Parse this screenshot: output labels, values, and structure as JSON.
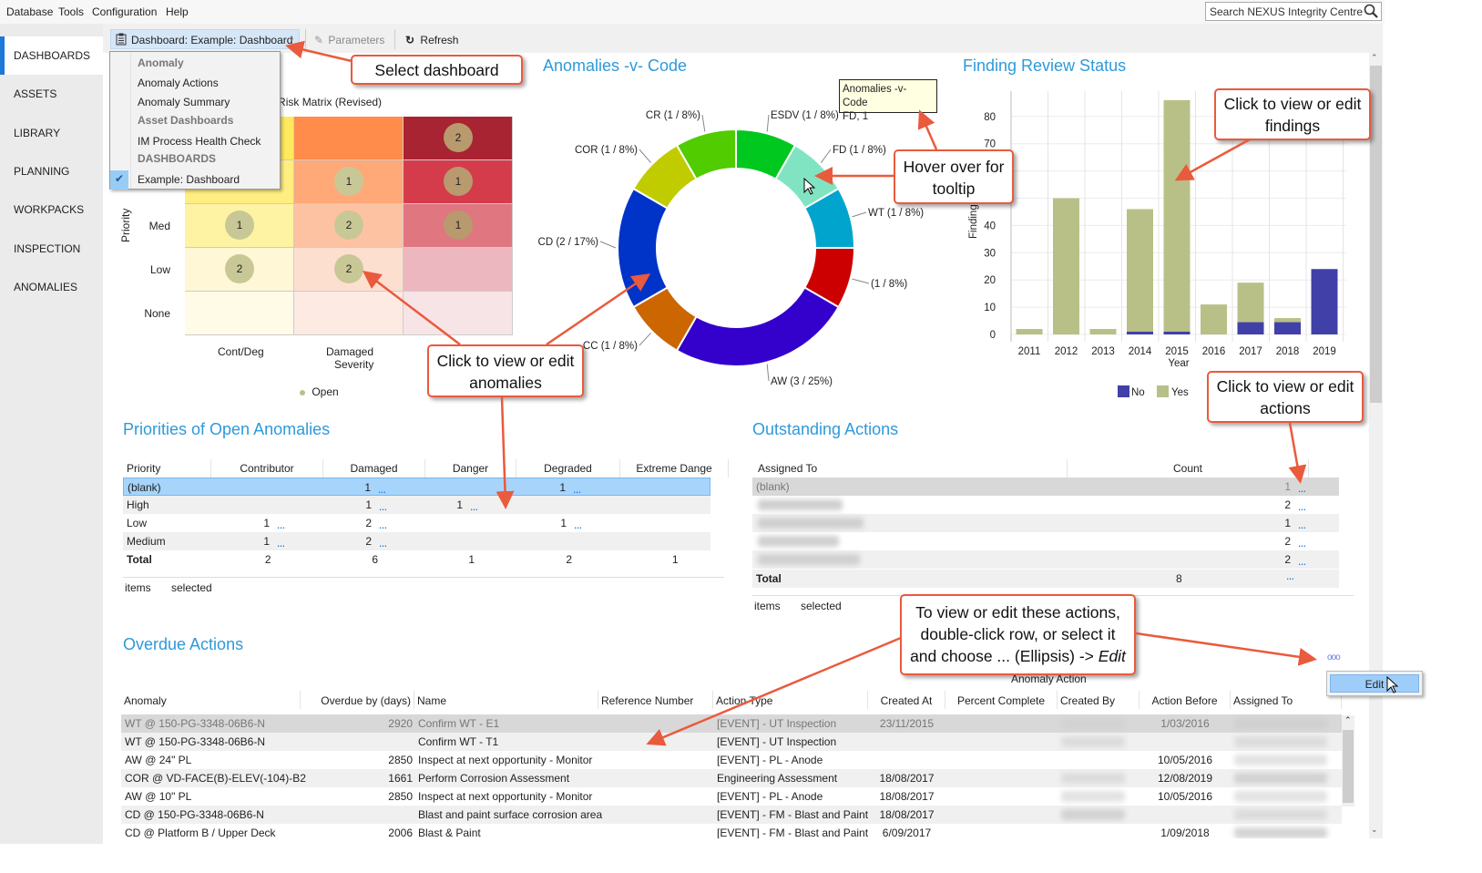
{
  "menu": {
    "items": [
      "Database",
      "Tools",
      "Configuration",
      "Help"
    ]
  },
  "search": {
    "placeholder": "Search NEXUS Integrity Centre"
  },
  "sidebar": {
    "items": [
      "DASHBOARDS",
      "ASSETS",
      "LIBRARY",
      "PLANNING",
      "WORKPACKS",
      "INSPECTION",
      "ANOMALIES"
    ],
    "selected": "DASHBOARDS"
  },
  "toolbar": {
    "dashboard_label": "Dashboard: Example: Dashboard",
    "parameters_label": "Parameters",
    "refresh_label": "Refresh"
  },
  "dropdown": {
    "items": [
      {
        "label": "Anomaly",
        "type": "header"
      },
      {
        "label": "Anomaly Actions",
        "type": "item"
      },
      {
        "label": "Anomaly Summary",
        "type": "item"
      },
      {
        "label": "Asset Dashboards",
        "type": "header"
      },
      {
        "label": "IM Process Health Check",
        "type": "item"
      },
      {
        "label": "DASHBOARDS",
        "type": "header"
      },
      {
        "label": "Example: Dashboard",
        "type": "item",
        "checked": true
      }
    ]
  },
  "risk_matrix": {
    "title": "Anomaly Risk Matrix (Revised)",
    "y_label": "Priority",
    "row_labels": [
      "",
      "",
      "Med",
      "Low",
      "None"
    ],
    "col_labels": [
      "Cont/Deg",
      "Damaged",
      ""
    ],
    "x_title": "Severity",
    "legend": "Open",
    "counts": [
      [
        null,
        null,
        2
      ],
      [
        null,
        1,
        1
      ],
      [
        1,
        2,
        1
      ],
      [
        2,
        2,
        null
      ],
      [
        null,
        null,
        null
      ]
    ],
    "colors": [
      [
        "#ffe95e",
        "#ff8c4a",
        "#a82432"
      ],
      [
        "#ffee80",
        "#ffa878",
        "#d53c4b"
      ],
      [
        "#fef3a2",
        "#fdc2a2",
        "#e07680"
      ],
      [
        "#fff7d6",
        "#fddfd0",
        "#edb7bf"
      ],
      [
        "#fffbe6",
        "#fdebe3",
        "#f7e4e7"
      ]
    ]
  },
  "donut": {
    "title": "Anomalies -v- Code",
    "segments": [
      {
        "code": "ESDV",
        "label": "ESDV (1 / 8%)",
        "value": 1,
        "color": "#00c81e"
      },
      {
        "code": "FD",
        "label": "FD (1 / 8%)",
        "value": 1,
        "color": "#80e4c2"
      },
      {
        "code": "WT",
        "label": "WT (1 / 8%)",
        "value": 1,
        "color": "#00a4cc"
      },
      {
        "code": "",
        "label": "(1 / 8%)",
        "value": 1,
        "color": "#cc0000"
      },
      {
        "code": "AW",
        "label": "AW (3 / 25%)",
        "value": 3,
        "color": "#3300cc"
      },
      {
        "code": "CC",
        "label": "CC (1 / 8%)",
        "value": 1,
        "color": "#cc6600"
      },
      {
        "code": "CD",
        "label": "CD (2 / 17%)",
        "value": 2,
        "color": "#0033c8"
      },
      {
        "code": "COR",
        "label": "COR (1 / 8%)",
        "value": 1,
        "color": "#c0cc00"
      },
      {
        "code": "CR",
        "label": "CR (1 / 8%)",
        "value": 1,
        "color": "#50cc00"
      }
    ]
  },
  "tooltip": {
    "line1": "Anomalies -v- Code",
    "line2": "FD, 1"
  },
  "chart_data": {
    "type": "bar",
    "stacked": true,
    "title": "Finding Review Status",
    "xlabel": "Year",
    "ylabel": "Finding",
    "categories": [
      "2011",
      "2012",
      "2013",
      "2014",
      "2015",
      "2016",
      "2017",
      "2018",
      "2019"
    ],
    "series": [
      {
        "name": "No",
        "color": "#4040a8",
        "values": [
          0,
          0,
          0,
          1,
          1,
          0,
          4.5,
          4.5,
          24
        ]
      },
      {
        "name": "Yes",
        "color": "#b8c088",
        "values": [
          2,
          50,
          2,
          45,
          85,
          11,
          14.5,
          1.5,
          0
        ]
      }
    ],
    "yticks": [
      0,
      10,
      20,
      30,
      40,
      70,
      80
    ],
    "ylim": [
      0,
      85
    ],
    "grid": true,
    "legend": "bottom"
  },
  "priorities": {
    "title": "Priorities of Open Anomalies",
    "columns": [
      "Priority",
      "Contributor",
      "Damaged",
      "Danger",
      "Degraded",
      "Extreme Dange"
    ],
    "rows": [
      {
        "label": "(blank)",
        "values": [
          "",
          "1",
          "",
          "1",
          ""
        ],
        "selected": true
      },
      {
        "label": "High",
        "values": [
          "",
          "1",
          "1",
          "",
          ""
        ]
      },
      {
        "label": "Low",
        "values": [
          "1",
          "2",
          "",
          "1",
          ""
        ]
      },
      {
        "label": "Medium",
        "values": [
          "1",
          "2",
          "",
          "",
          ""
        ]
      }
    ],
    "total": {
      "label": "Total",
      "values": [
        "2",
        "6",
        "1",
        "2",
        "1"
      ]
    },
    "footer_items": "items",
    "footer_selected": "selected"
  },
  "outstanding": {
    "title": "Outstanding Actions",
    "columns": [
      "Assigned To",
      "Count"
    ],
    "rows": [
      {
        "label": "(blank)",
        "count": "1"
      },
      {
        "label": "",
        "count": "2"
      },
      {
        "label": "",
        "count": "1"
      },
      {
        "label": "",
        "count": "2"
      },
      {
        "label": "",
        "count": "2"
      }
    ],
    "total": {
      "label": "Total",
      "count": "8"
    },
    "footer_items": "items",
    "footer_selected": "selected"
  },
  "overdue": {
    "title": "Overdue Actions",
    "group_header": "Anomaly Action",
    "columns": [
      "Anomaly",
      "Overdue by (days)",
      "Name",
      "Reference Number",
      "Action Type",
      "Created At",
      "Percent Complete",
      "Created By",
      "Action Before",
      "Assigned To"
    ],
    "rows": [
      [
        "WT @ 150-PG-3348-06B6-N",
        "2920",
        "Confirm WT - E1",
        "",
        "[EVENT] - UT Inspection",
        "23/11/2015",
        "",
        "",
        "1/03/2016",
        ""
      ],
      [
        "WT @ 150-PG-3348-06B6-N",
        "",
        "Confirm WT - T1",
        "",
        "[EVENT] - UT Inspection",
        "",
        "",
        "",
        "",
        ""
      ],
      [
        "AW @ 24\" PL",
        "2850",
        "Inspect at next opportunity - Monitor",
        "",
        "[EVENT] - PL - Anode",
        "",
        "",
        "",
        "10/05/2016",
        ""
      ],
      [
        "COR @ VD-FACE(B)-ELEV(-104)-B2",
        "1661",
        "Perform Corrosion Assessment",
        "",
        "Engineering Assessment",
        "18/08/2017",
        "",
        "",
        "12/08/2019",
        ""
      ],
      [
        "AW @ 10\" PL",
        "2850",
        "Inspect at next opportunity - Monitor",
        "",
        "[EVENT] - PL - Anode",
        "18/08/2017",
        "",
        "",
        "10/05/2016",
        ""
      ],
      [
        "CD @ 150-PG-3348-06B6-N",
        "",
        "Blast and paint surface corrosion area",
        "",
        "[EVENT] - FM - Blast and Paint",
        "18/08/2017",
        "",
        "",
        "",
        ""
      ],
      [
        "CD @ Platform B / Upper Deck",
        "2006",
        "Blast & Paint",
        "",
        "[EVENT] - FM - Blast and Paint",
        "6/09/2017",
        "",
        "",
        "1/09/2018",
        ""
      ]
    ],
    "ellipsis_label": "ooo",
    "edit_label": "Edit"
  },
  "ellipsis": "…",
  "callouts": {
    "select_dashboard": "Select dashboard",
    "hover_tooltip": "Hover over for tooltip",
    "findings": "Click to view or edit findings",
    "anomalies": "Click to view or edit anomalies",
    "actions": "Click to view or edit actions",
    "edit_actions_1": "To view or edit these actions, double-click row, or select it and choose ... (Ellipsis) -> ",
    "edit_actions_2": "Edit"
  }
}
